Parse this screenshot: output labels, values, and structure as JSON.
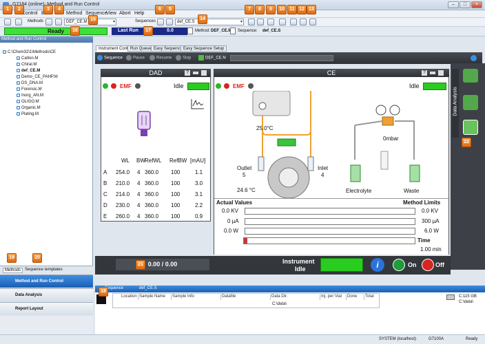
{
  "window": {
    "title": "G7184 (online): Method and Run Control"
  },
  "menu": [
    "Control",
    "B",
    "Method",
    "Sequence",
    "View",
    "Abort",
    "Help"
  ],
  "toolbar": {
    "methods_label": "Methods",
    "method_value": "DEF_CE.M",
    "sequences_label": "Sequences",
    "sequence_value": "def_CE.S"
  },
  "status": {
    "ready": "Ready",
    "last_run": "Last Run",
    "last_run_value": "0.0",
    "method_label": "Method:",
    "method_value": "DEF_CE.M",
    "sequence_label": "Sequence:",
    "sequence_value": "def_CE.S"
  },
  "left_panel": {
    "title": "Method and Run Control",
    "root": "C:\\Chem32\\1\\Methods\\CE",
    "items": [
      "CatIon.M",
      "Chiral.M",
      "def_CE.M",
      "Demo_CE_PAHP.M",
      "DS_DNA.M",
      "Forensic.M",
      "Inorg_AN.M",
      "OLIGO.M",
      "Organic.M",
      "Plating.M"
    ],
    "tabs": [
      "Methods",
      "Sequence templates"
    ],
    "nav": [
      "Method and Run Control",
      "Data Analysis",
      "Report Layout"
    ]
  },
  "inner_tabs": [
    "Instrument Control",
    "Run Queue",
    "Easy Sequence",
    "Easy Sequence Setup"
  ],
  "seq_controls": {
    "sequence": "Sequence",
    "pause": "Pause",
    "resume": "Resume",
    "stop": "Stop",
    "seq_name": "DEF_CE.N"
  },
  "dad": {
    "title": "DAD",
    "idle": "Idle",
    "emf": "EMF",
    "headers": [
      "WL",
      "BW",
      "RefWL",
      "RefBW",
      "[mAU]"
    ],
    "rows": [
      {
        "k": "A",
        "wl": "254.0",
        "bw": "4",
        "ref": "360.0",
        "refbw": "100",
        "mau": "1.1"
      },
      {
        "k": "B",
        "wl": "210.0",
        "bw": "4",
        "ref": "360.0",
        "refbw": "100",
        "mau": "3.0"
      },
      {
        "k": "C",
        "wl": "214.0",
        "bw": "4",
        "ref": "360.0",
        "refbw": "100",
        "mau": "3.1"
      },
      {
        "k": "D",
        "wl": "230.0",
        "bw": "4",
        "ref": "360.0",
        "refbw": "100",
        "mau": "2.2"
      },
      {
        "k": "E",
        "wl": "260.0",
        "bw": "4",
        "ref": "360.0",
        "refbw": "100",
        "mau": "0.9"
      }
    ]
  },
  "ce": {
    "title": "CE",
    "idle": "Idle",
    "emf": "EMF",
    "temp_top": "25.0°C",
    "pressure": "0mbar",
    "outlet": "Outlet",
    "outlet_no": "5",
    "inlet": "Inlet",
    "inlet_no": "4",
    "temp_bottom": "24.6 °C",
    "electrolyte": "Electrolyte",
    "waste": "Waste",
    "actual_label": "Actual Values",
    "limits_label": "Method Limits",
    "actual": [
      "0.0 KV",
      "0 µA",
      "0.0 W"
    ],
    "limits": [
      "0.0 KV",
      "300 µA",
      "6.0 W"
    ],
    "time_label": "Time",
    "time_value": "1.00 min"
  },
  "run_bar": {
    "progress": "0.00 / 0.00",
    "instrument_label": "Instrument",
    "idle_label": "Idle",
    "on": "On",
    "off": "Off"
  },
  "analysis": {
    "label": "Data Analysis"
  },
  "seq_table": {
    "tab1": "Sequence",
    "tab2": "def_CE.S",
    "headers": [
      "Location",
      "Sample Name",
      "Sample Info",
      "Datafile",
      "Data Dir.",
      "Inj. per Vial",
      "Done",
      "Total"
    ],
    "data_dir": "C:\\data\\"
  },
  "disk": {
    "size": "C:115 GB",
    "path": "C:\\data\\"
  },
  "sysbar": {
    "user": "SYSTEM (localhost)",
    "instrument": "G7100A",
    "ready": "Ready"
  },
  "callouts": [
    "1",
    "2",
    "3",
    "4",
    "5",
    "6",
    "7",
    "8",
    "9",
    "10",
    "11",
    "12",
    "13",
    "14",
    "15",
    "16",
    "17",
    "18",
    "19",
    "20",
    "21",
    "22"
  ]
}
